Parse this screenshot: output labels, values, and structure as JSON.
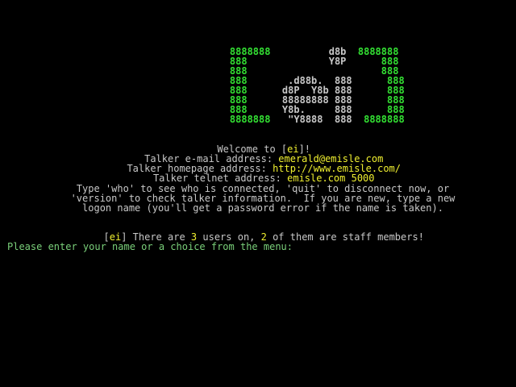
{
  "colors": {
    "background": "#000000",
    "text": "#c0c0c0",
    "green": "#33e033",
    "yellow": "#f0f030",
    "prompt_green": "#7ad07a"
  },
  "banner": {
    "rows": [
      {
        "green1": "8888888",
        "grey": "          ",
        "grey2": "d8b",
        "green2": "  8888888"
      },
      {
        "green1": "888    ",
        "grey": "          ",
        "grey2": "Y8P",
        "green2": "      888"
      },
      {
        "green1": "888    ",
        "grey": "             ",
        "grey2": "",
        "green2": "      888"
      },
      {
        "green1": "888    ",
        "grey": "   .d88b.  ",
        "grey2": "888",
        "green2": "      888"
      },
      {
        "green1": "888    ",
        "grey": "  d8P  Y8b ",
        "grey2": "888",
        "green2": "      888"
      },
      {
        "green1": "888    ",
        "grey": "  88888888 ",
        "grey2": "888",
        "green2": "      888"
      },
      {
        "green1": "888    ",
        "grey": "  Y8b.     ",
        "grey2": "888",
        "green2": "      888"
      },
      {
        "green1": "8888888",
        "grey": "   \"Y8888  ",
        "grey2": "888",
        "green2": "  8888888"
      }
    ]
  },
  "welcome": {
    "prefix": "Welcome to [",
    "tag": "ei",
    "suffix": "]!"
  },
  "info": {
    "email_label": "Talker e-mail address: ",
    "email_value": "emerald@emisle.com",
    "homepage_label": "Talker homepage address: ",
    "homepage_value": "http://www.emisle.com/",
    "telnet_label": "Talker telnet address: ",
    "telnet_value": "emisle.com 5000"
  },
  "instructions": {
    "line1": "Type 'who' to see who is connected, 'quit' to disconnect now, or",
    "line2": "'version' to check talker information.  If you are new, type a new",
    "line3": "logon name (you'll get a password error if the name is taken)."
  },
  "status": {
    "open": "[",
    "tag": "ei",
    "close": "] There are ",
    "users": "3",
    "mid": " users on, ",
    "staff": "2",
    "end": " of them are staff members!"
  },
  "prompt": {
    "text": "Please enter your name or a choice from the menu:"
  }
}
